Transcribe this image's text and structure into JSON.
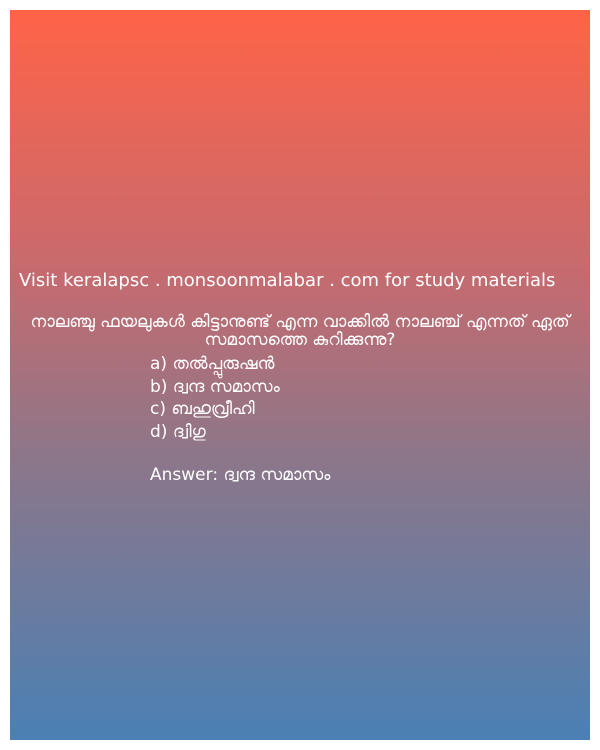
{
  "colors": {
    "gradient_top": "#ff6347",
    "gradient_bottom": "#4a80b4",
    "text": "#ffffff"
  },
  "card": {
    "visit_text": "Visit keralapsc . monsoonmalabar . com for study materials",
    "question": "നാലഞ്ചു ഫയലുകൾ കിട്ടാനുണ്ട് എന്ന വാക്കിൽ നാലഞ്ച് എന്നത് ഏത് സമാസത്തെ കുറിക്കുന്നു?",
    "options": [
      {
        "label": "a) തൽപ്പുരുഷൻ"
      },
      {
        "label": "b) ദ്വന്ദ സമാസം"
      },
      {
        "label": "c) ബഹുവ്രീഹി"
      },
      {
        "label": "d) ദ്വിഗു"
      }
    ],
    "answer": "Answer: ദ്വന്ദ സമാസം"
  }
}
